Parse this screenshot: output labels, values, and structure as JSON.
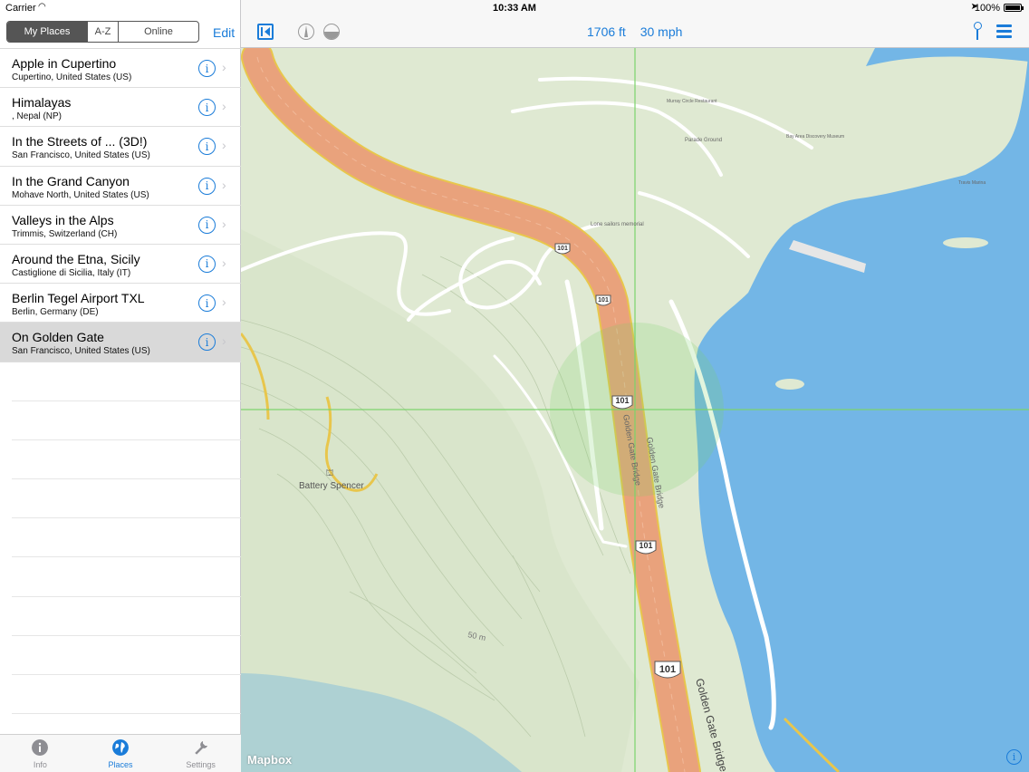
{
  "status_bar": {
    "carrier": "Carrier",
    "time": "10:33 AM",
    "battery": "100%"
  },
  "sidebar": {
    "segments": [
      "My Places",
      "A-Z",
      "Online"
    ],
    "selected_segment": "My Places",
    "edit_label": "Edit",
    "places": [
      {
        "title": "Apple in Cupertino",
        "subtitle": "Cupertino, United States (US)"
      },
      {
        "title": "Himalayas",
        "subtitle": ", Nepal (NP)"
      },
      {
        "title": "In the Streets of ... (3D!)",
        "subtitle": "San Francisco, United States (US)"
      },
      {
        "title": "In the Grand Canyon",
        "subtitle": "Mohave North, United States (US)"
      },
      {
        "title": "Valleys in the Alps",
        "subtitle": "Trimmis, Switzerland (CH)"
      },
      {
        "title": "Around the Etna, Sicily",
        "subtitle": "Castiglione di Sicilia, Italy (IT)"
      },
      {
        "title": "Berlin Tegel Airport TXL",
        "subtitle": "Berlin, Germany (DE)"
      },
      {
        "title": "On Golden Gate",
        "subtitle": "San Francisco, United States (US)"
      }
    ],
    "selected_place": "On Golden Gate",
    "tabs": [
      {
        "label": "Info",
        "icon": "info-icon"
      },
      {
        "label": "Places",
        "icon": "globe-icon"
      },
      {
        "label": "Settings",
        "icon": "wrench-icon"
      }
    ],
    "active_tab": "Places"
  },
  "toolbar": {
    "altitude": "1706 ft",
    "speed": "30 mph"
  },
  "map": {
    "attribution": "Mapbox",
    "labels": {
      "battery_spencer": "Battery Spencer",
      "golden_gate_bridge": "Golden Gate Bridge",
      "route_101": "101",
      "contour": "50 m",
      "lone_sailors": "Lone sailors memorial",
      "parade_ground": "Parade Ground",
      "murray_circle": "Murray Circle Restaurant",
      "bay_area_museum": "Bay Area Discovery Museum",
      "travis_marina": "Travis Marina"
    },
    "colors": {
      "land": "#dfe9d2",
      "water": "#73b6e6",
      "highway": "#e9a27c",
      "highway_edge": "#e8c64c",
      "crosshair": "#7bd36b"
    }
  }
}
